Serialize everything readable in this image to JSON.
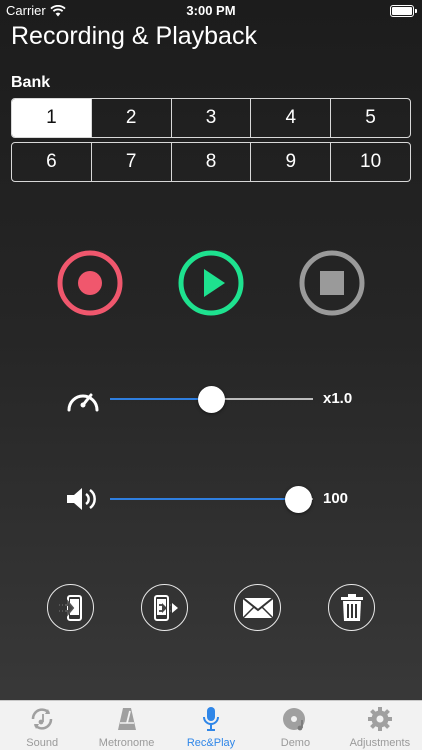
{
  "status_bar": {
    "carrier": "Carrier",
    "time": "3:00 PM"
  },
  "page": {
    "title": "Recording & Playback"
  },
  "bank": {
    "label": "Bank",
    "selected": "1",
    "row1": [
      "1",
      "2",
      "3",
      "4",
      "5"
    ],
    "row2": [
      "6",
      "7",
      "8",
      "9",
      "10"
    ]
  },
  "transport": {
    "record_color": "#f0576d",
    "play_color": "#1ee28f",
    "stop_color": "#9a9a9a"
  },
  "speed_slider": {
    "value_label": "x1.0",
    "fraction": 0.5
  },
  "volume_slider": {
    "value_label": "100",
    "fraction": 0.93
  },
  "colors": {
    "slider_fill": "#2f7fe0",
    "tab_active": "#2f86e8"
  },
  "tabs": [
    {
      "label": "Sound",
      "icon": "sound-icon",
      "active": false
    },
    {
      "label": "Metronome",
      "icon": "metronome-icon",
      "active": false
    },
    {
      "label": "Rec&Play",
      "icon": "microphone-icon",
      "active": true
    },
    {
      "label": "Demo",
      "icon": "demo-disc-icon",
      "active": false
    },
    {
      "label": "Adjustments",
      "icon": "gear-icon",
      "active": false
    }
  ]
}
